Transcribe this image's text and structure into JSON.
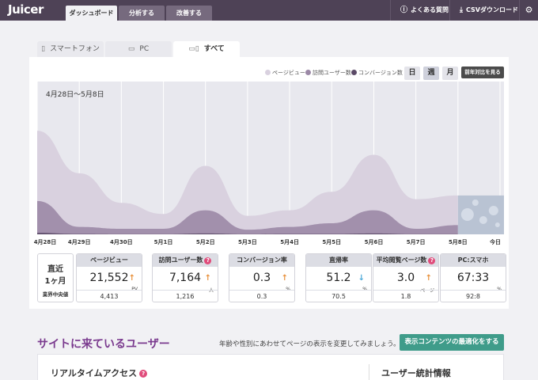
{
  "app": {
    "logo": "Juicer"
  },
  "top_tabs": [
    "ダッシュボード",
    "分析する",
    "改善する"
  ],
  "top_right": {
    "faq": "よくある質問",
    "csv": "CSVダウンロード"
  },
  "device_tabs": [
    "スマートフォン",
    "PC",
    "すべて"
  ],
  "legend": [
    {
      "label": "ページビュー",
      "color": "#d9d1df"
    },
    {
      "label": "訪問ユーザー数",
      "color": "#9b88a6"
    },
    {
      "label": "コンバージョン数",
      "color": "#5b4a67"
    }
  ],
  "period_buttons": [
    "日",
    "週",
    "月"
  ],
  "compare_button": "前年対比を見る",
  "date_range": "4月28日〜5月8日",
  "chart_data": {
    "type": "area",
    "x": [
      "4月28日",
      "4月29日",
      "4月30日",
      "5月1日",
      "5月2日",
      "5月3日",
      "5月4日",
      "5月5日",
      "5月6日",
      "5月7日",
      "5月8日",
      "今日"
    ],
    "series": [
      {
        "name": "ページビュー",
        "values": [
          5600,
          3300,
          1700,
          1100,
          3700,
          1000,
          1300,
          2300,
          4300,
          1900,
          2100,
          2100
        ]
      },
      {
        "name": "訪問ユーザー数",
        "values": [
          1800,
          400,
          300,
          300,
          1300,
          250,
          400,
          600,
          1300,
          300,
          500,
          500
        ]
      },
      {
        "name": "コンバージョン数",
        "values": [
          80,
          20,
          10,
          10,
          50,
          10,
          20,
          20,
          50,
          10,
          10,
          10
        ]
      }
    ],
    "ylim": [
      0,
      8000
    ],
    "grid": true
  },
  "summary": {
    "period_label1": "直近",
    "period_label2": "1ヶ月",
    "median_label": "業界中央値"
  },
  "metrics": [
    {
      "header": "ページビュー",
      "value": "21,552",
      "unit": "PV",
      "median": "4,413",
      "trend": "up",
      "help": false
    },
    {
      "header": "訪問ユーザー数",
      "value": "7,164",
      "unit": "人",
      "median": "1,216",
      "trend": "up",
      "help": true
    },
    {
      "header": "コンバージョン率",
      "value": "0.3",
      "unit": "%",
      "median": "0.3",
      "trend": "up",
      "help": false
    },
    {
      "header": "直帰率",
      "value": "51.2",
      "unit": "%",
      "median": "70.5",
      "trend": "down",
      "help": false
    },
    {
      "header": "平均閲覧ページ数",
      "value": "3.0",
      "unit": "ページ",
      "median": "1.8",
      "trend": "up",
      "help": true
    },
    {
      "header": "PC:スマホ",
      "value": "67:33",
      "unit": "%",
      "median": "92:8",
      "trend": "none",
      "help": false
    }
  ],
  "section": {
    "title": "サイトに来ているユーザー",
    "desc": "年齢や性別にあわせてページの表示を変更してみましょう。",
    "button": "表示コンテンツの最適化をする"
  },
  "realtime_title": "リアルタイムアクセス",
  "user_stats_title": "ユーザー統計情報",
  "help_mark": "?"
}
